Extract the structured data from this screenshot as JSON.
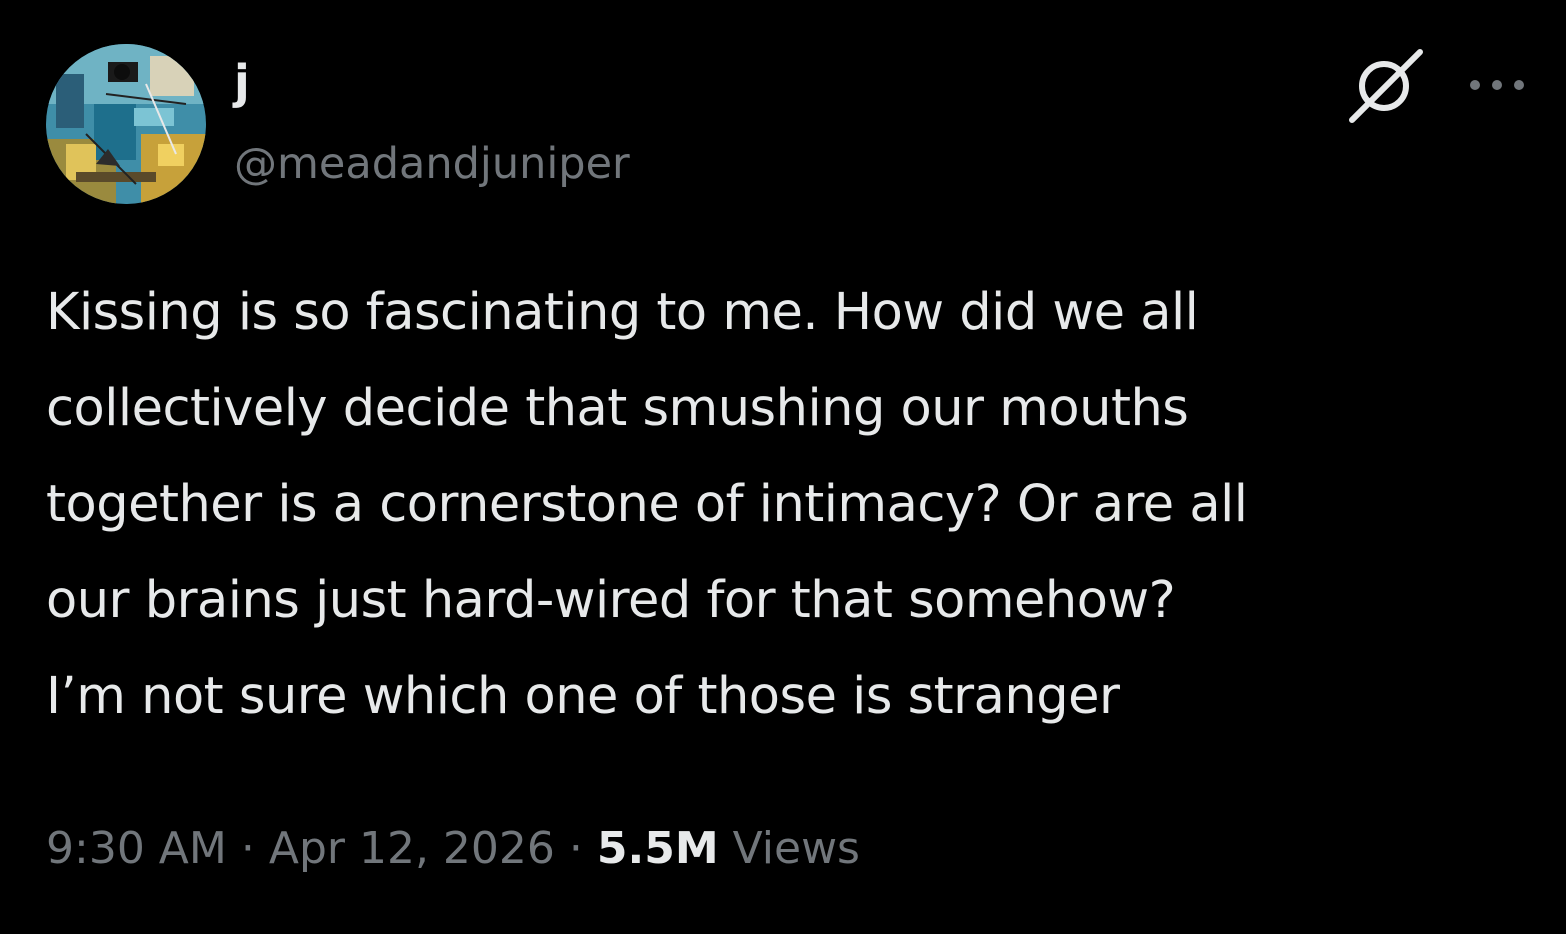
{
  "author": {
    "display_name": "j",
    "handle": "@meadandjuniper"
  },
  "tweet": {
    "text_lines": [
      "Kissing is so fascinating to me. How did we all",
      "collectively decide that smushing our mouths",
      "together is a cornerstone of intimacy? Or are all",
      "our brains just hard-wired for that somehow?",
      "I’m not sure which one of those is stranger"
    ],
    "time": "9:30 AM",
    "separator": "·",
    "date": "Apr 12, 2026",
    "views_count": "5.5M",
    "views_label": "Views"
  },
  "icons": {
    "grok": "grok-icon",
    "more": "more-options-icon"
  },
  "colors": {
    "background": "#000000",
    "primary_text": "#e7e9ea",
    "secondary_text": "#71767b"
  }
}
